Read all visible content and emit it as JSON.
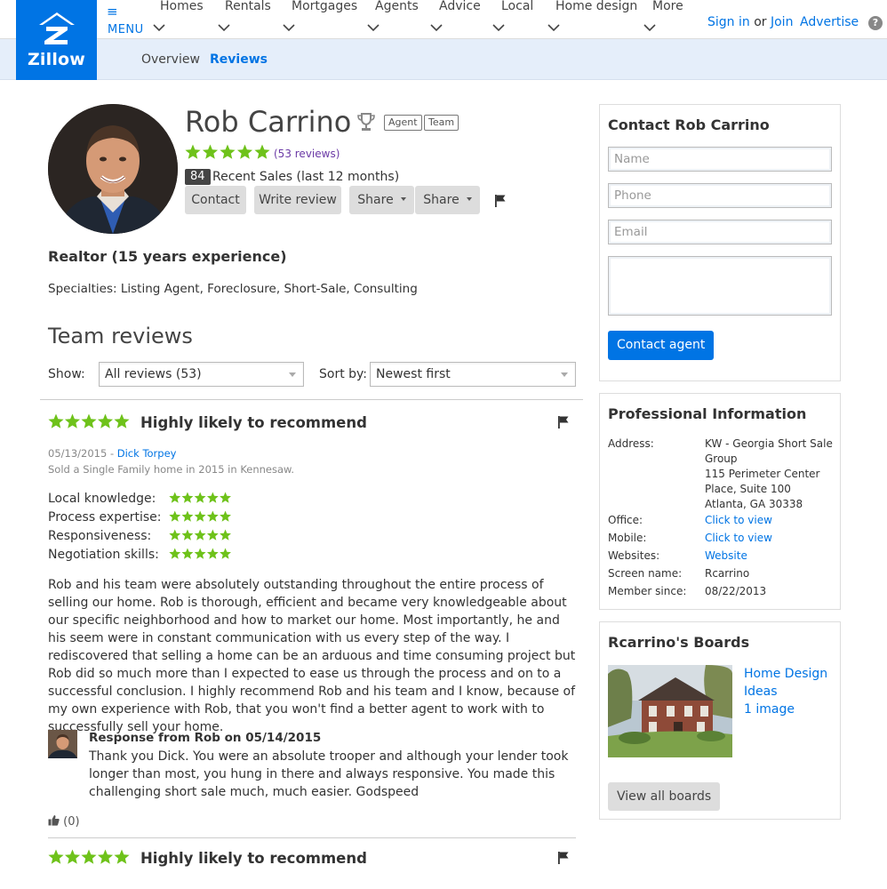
{
  "header": {
    "brand": "Zillow",
    "menu_label": "MENU",
    "nav": [
      "Homes",
      "Rentals",
      "Mortgages",
      "Agents",
      "Advice",
      "Local",
      "Home design",
      "More"
    ],
    "sign_in": "Sign in",
    "or": "or",
    "join": "Join",
    "advertise": "Advertise",
    "help": "?"
  },
  "subnav": {
    "overview": "Overview",
    "reviews": "Reviews"
  },
  "profile": {
    "name": "Rob Carrino",
    "tags": [
      "Agent",
      "Team"
    ],
    "rating": 5,
    "reviews_link": "(53 reviews)",
    "recent_sales_count": "84",
    "recent_sales_text": "Recent Sales (last 12 months)",
    "buttons": {
      "contact": "Contact",
      "write_review": "Write review",
      "share1": "Share",
      "share2": "Share"
    },
    "headline": "Realtor (15 years experience)",
    "specialties": "Specialties: Listing Agent, Foreclosure, Short-Sale, Consulting"
  },
  "reviews": {
    "heading": "Team reviews",
    "show_label": "Show:",
    "show_value": "All reviews (53)",
    "sort_label": "Sort by:",
    "sort_value": "Newest first",
    "items": [
      {
        "title": "Highly likely to recommend",
        "date": "05/13/2015 - ",
        "author": "Dick Torpey",
        "sold": "Sold a Single Family home in 2015 in Kennesaw.",
        "ratings": [
          {
            "label": "Local knowledge:",
            "stars": 5
          },
          {
            "label": "Process expertise:",
            "stars": 5
          },
          {
            "label": "Responsiveness:",
            "stars": 5
          },
          {
            "label": "Negotiation skills:",
            "stars": 5
          }
        ],
        "body": "Rob and his team were absolutely outstanding throughout the entire process of selling our home. Rob is thorough, efficient and became very knowledgeable about our specific neighborhood and how to market our home.  Most importantly, he and his seem were in constant communication with us every step of the way. I rediscovered that selling a home can be an arduous and time consuming project but Rob did so much more than I expected to ease us through the process and on to a successful conclusion. I highly recommend Rob and his team and I know, because of my own experience with Rob, that you won't find a better agent to work with to successfully sell your home.",
        "response_title": "Response from Rob on 05/14/2015",
        "response_body": "Thank you Dick. You were an absolute trooper and although your lender took longer than most, you hung in there and always responsive. You made this challenging short sale much, much easier. Godspeed",
        "helpful": "(0)"
      },
      {
        "title": "Highly likely to recommend"
      }
    ]
  },
  "contact": {
    "title": "Contact Rob Carrino",
    "name_ph": "Name",
    "phone_ph": "Phone",
    "email_ph": "Email",
    "button": "Contact agent"
  },
  "pro_info": {
    "title": "Professional Information",
    "rows": [
      {
        "label": "Address:",
        "lines": [
          "KW - Georgia Short Sale",
          "Group",
          "115 Perimeter Center",
          "Place, Suite 100",
          "Atlanta, GA  30338"
        ],
        "link": false
      },
      {
        "label": "Office:",
        "lines": [
          "Click to view"
        ],
        "link": true
      },
      {
        "label": "Mobile:",
        "lines": [
          "Click to view"
        ],
        "link": true
      },
      {
        "label": "Websites:",
        "lines": [
          "Website"
        ],
        "link": true
      },
      {
        "label": "Screen name:",
        "lines": [
          "Rcarrino"
        ],
        "link": false
      },
      {
        "label": "Member since:",
        "lines": [
          "08/22/2013"
        ],
        "link": false
      }
    ]
  },
  "boards": {
    "title": "Rcarrino's Boards",
    "board_name_1": "Home Design",
    "board_name_2": "Ideas",
    "count": "1 image",
    "view_all": "View all boards"
  },
  "colors": {
    "brand": "#0074e4",
    "star": "#6ec21a",
    "subnav_bg": "#e5eefa"
  }
}
